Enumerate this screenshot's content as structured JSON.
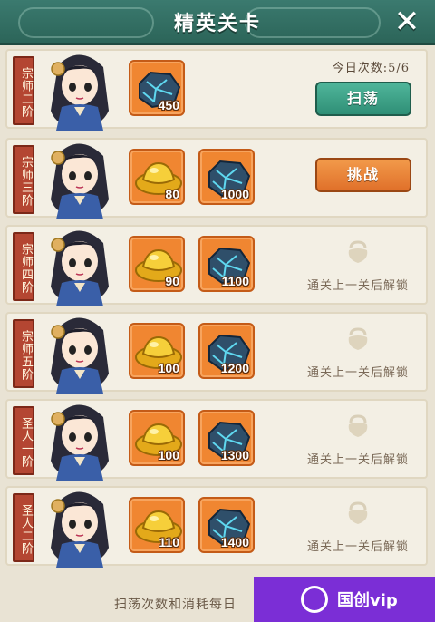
{
  "header": {
    "title": "精英关卡",
    "close_icon": "close-icon"
  },
  "daily_count": "今日次数:5/6",
  "buttons": {
    "sweep": "扫荡",
    "challenge": "挑战"
  },
  "locked_text": "通关上一关后解锁",
  "stages": [
    {
      "rank": "宗师二阶",
      "rewards": [
        {
          "type": "blue-ore",
          "count": "450"
        }
      ],
      "status": "sweep"
    },
    {
      "rank": "宗师三阶",
      "rewards": [
        {
          "type": "gold-ingot",
          "count": "80"
        },
        {
          "type": "blue-ore",
          "count": "1000"
        }
      ],
      "status": "challenge"
    },
    {
      "rank": "宗师四阶",
      "rewards": [
        {
          "type": "gold-ingot",
          "count": "90"
        },
        {
          "type": "blue-ore",
          "count": "1100"
        }
      ],
      "status": "locked"
    },
    {
      "rank": "宗师五阶",
      "rewards": [
        {
          "type": "gold-ingot",
          "count": "100"
        },
        {
          "type": "blue-ore",
          "count": "1200"
        }
      ],
      "status": "locked"
    },
    {
      "rank": "圣人一阶",
      "rewards": [
        {
          "type": "gold-ingot",
          "count": "100"
        },
        {
          "type": "blue-ore",
          "count": "1300"
        }
      ],
      "status": "locked"
    },
    {
      "rank": "圣人二阶",
      "rewards": [
        {
          "type": "gold-ingot",
          "count": "110"
        },
        {
          "type": "blue-ore",
          "count": "1400"
        }
      ],
      "status": "locked"
    }
  ],
  "footer": "扫荡次数和消耗每日",
  "watermark": "国创vip",
  "colors": {
    "header": "#2c6559",
    "rank_tag": "#b44632",
    "item_bg": "#f08631",
    "sweep_btn": "#2f8f76",
    "challenge_btn": "#e0702a"
  }
}
